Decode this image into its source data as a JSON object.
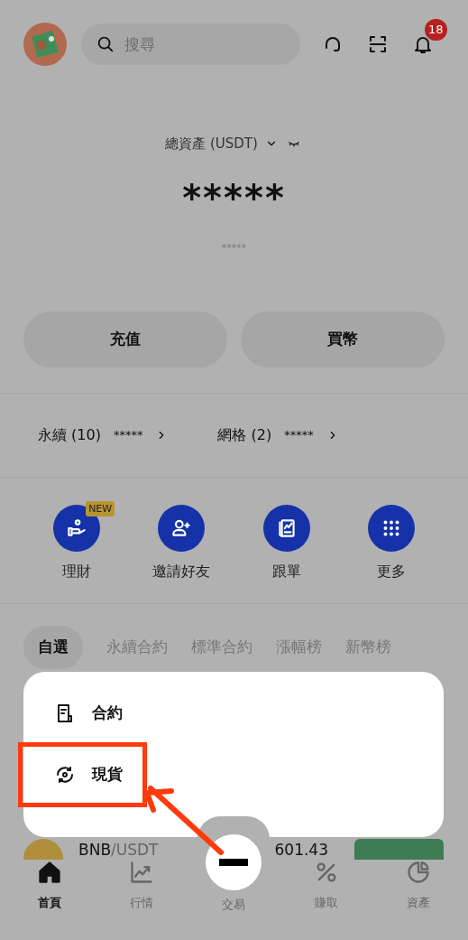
{
  "header": {
    "search": {
      "placeholder": "搜尋"
    },
    "notification_count": "18"
  },
  "balance": {
    "label": "總資產 (USDT)",
    "value": "*****",
    "sub_value": "*****"
  },
  "actions": [
    "充值",
    "買幣"
  ],
  "positions": [
    {
      "label": "永續 (10)",
      "value": "*****"
    },
    {
      "label": "網格 (2)",
      "value": "*****"
    }
  ],
  "shortcuts": [
    {
      "kind": "earn",
      "label": "理財",
      "badge": "NEW"
    },
    {
      "kind": "invite",
      "label": "邀請好友"
    },
    {
      "kind": "copy",
      "label": "跟單"
    },
    {
      "kind": "more",
      "label": "更多"
    }
  ],
  "market_tabs": [
    {
      "label": "自選",
      "selected": true
    },
    {
      "label": "永續合約",
      "selected": false
    },
    {
      "label": "標準合約",
      "selected": false
    },
    {
      "label": "漲幅榜",
      "selected": false
    },
    {
      "label": "新幣榜",
      "selected": false
    }
  ],
  "market_row": {
    "base": "BNB",
    "quote": "/USDT",
    "price": "601.43"
  },
  "trade_menu": [
    {
      "kind": "contract",
      "label": "合約",
      "highlighted": false
    },
    {
      "kind": "spot",
      "label": "現貨",
      "highlighted": true
    }
  ],
  "bottom_nav": [
    {
      "kind": "home",
      "label": "首頁",
      "selected": true
    },
    {
      "kind": "markets",
      "label": "行情",
      "selected": false
    },
    {
      "kind": "trade",
      "label": "交易",
      "selected": false
    },
    {
      "kind": "earn",
      "label": "賺取",
      "selected": false
    },
    {
      "kind": "assets",
      "label": "資產",
      "selected": false
    }
  ]
}
